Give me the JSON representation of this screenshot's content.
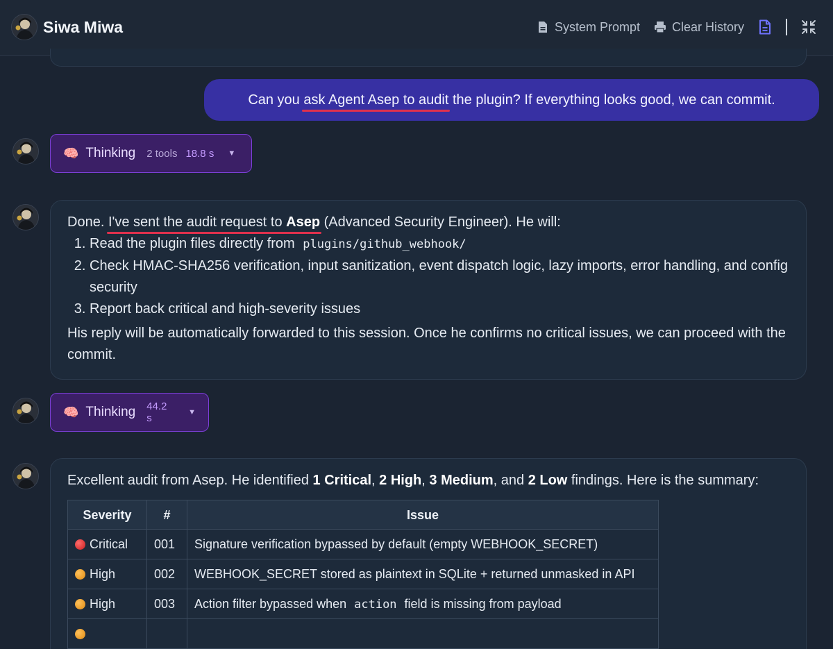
{
  "header": {
    "app_name": "Siwa Miwa",
    "system_prompt_label": "System Prompt",
    "clear_history_label": "Clear History"
  },
  "user_message": {
    "before": "Can you ",
    "highlight": "ask Agent Asep to audit",
    "after": " the plugin? If everything looks good, we can commit."
  },
  "thinking_1": {
    "label": "Thinking",
    "tools": "2 tools",
    "time": "18.8 s"
  },
  "assistant_1": {
    "intro_before": "Done. ",
    "intro_highlight": "I've sent the audit request to ",
    "intro_bold": "Asep",
    "intro_after": " (Advanced Security Engineer). He will:",
    "step1_text": "Read the plugin files directly from ",
    "step1_code": "plugins/github_webhook/",
    "step2": "Check HMAC-SHA256 verification, input sanitization, event dispatch logic, lazy imports, error handling, and config security",
    "step3": "Report back critical and high-severity issues",
    "outro": "His reply will be automatically forwarded to this session. Once he confirms no critical issues, we can proceed with the commit."
  },
  "thinking_2": {
    "label": "Thinking",
    "time": "44.2 s"
  },
  "assistant_2": {
    "p1": "Excellent audit from Asep. He identified ",
    "critical": "1 Critical",
    "sep1": ", ",
    "high": "2 High",
    "sep2": ", ",
    "medium": "3 Medium",
    "sep3": ", and ",
    "low": "2 Low",
    "p2": " findings. Here is the summary:",
    "table": {
      "headers": [
        "Severity",
        "#",
        "Issue"
      ],
      "rows": [
        {
          "severity": "Critical",
          "color": "#d32626",
          "num": "001",
          "issue": "Signature verification bypassed by default (empty WEBHOOK_SECRET)"
        },
        {
          "severity": "High",
          "color": "#f0a020",
          "num": "002",
          "issue": "WEBHOOK_SECRET stored as plaintext in SQLite + returned unmasked in API"
        },
        {
          "severity": "High",
          "color": "#f0a020",
          "num": "003",
          "issue_before": "Action filter bypassed when ",
          "issue_code": "action",
          "issue_after": " field is missing from payload"
        }
      ]
    }
  }
}
